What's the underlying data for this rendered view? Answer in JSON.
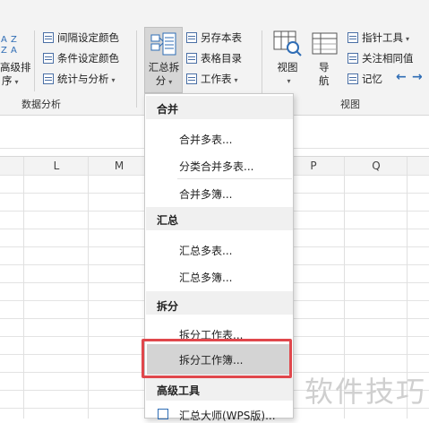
{
  "ribbon": {
    "sort_label_line1": "高级排",
    "sort_label_line2": "序",
    "interval_color": "间隔设定颜色",
    "cond_color": "条件设定颜色",
    "stats": "统计与分析",
    "data_analysis_group": "数据分析",
    "summary_split_line1": "汇总拆",
    "summary_split_line2": "分",
    "save_as_table": "另存本表",
    "table_contents": "表格目录",
    "worksheet": "工作表",
    "view": "视图",
    "nav_line1": "导",
    "nav_line2": "航",
    "pointer_tool": "指针工具",
    "focus_values": "关注相同值",
    "memo": "记忆",
    "view_group": "视图"
  },
  "columns": [
    "L",
    "M",
    "P",
    "Q"
  ],
  "menu": {
    "sections": [
      {
        "header": "合并",
        "items": [
          "合并多表...",
          "分类合并多表...",
          "合并多簿..."
        ]
      },
      {
        "header": "汇总",
        "items": [
          "汇总多表...",
          "汇总多簿..."
        ]
      },
      {
        "header": "拆分",
        "items": [
          "拆分工作表...",
          "拆分工作簿..."
        ]
      },
      {
        "header": "高级工具",
        "items": [
          "汇总大师(WPS版)..."
        ]
      }
    ],
    "highlighted": "拆分工作簿..."
  },
  "watermark": "软件技巧",
  "colors": {
    "highlight_border": "#e0474c",
    "menu_highlight": "#d4d4d4"
  }
}
